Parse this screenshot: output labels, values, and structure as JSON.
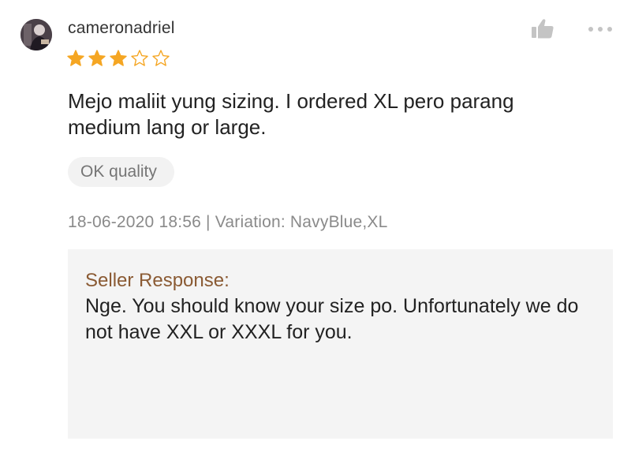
{
  "review": {
    "avatar_icon": "user-avatar",
    "username": "cameronadriel",
    "rating": 3,
    "rating_max": 5,
    "star_filled_color": "#f5a623",
    "like_icon": "thumbs-up-icon",
    "more_icon": "more-horizontal-icon",
    "text": "Mejo maliit yung sizing. I ordered XL pero parang medium lang or large.",
    "tag": "OK quality",
    "meta": "18-06-2020 18:56 | Variation: NavyBlue,XL"
  },
  "seller_response": {
    "title": "Seller Response:",
    "text": "Nge. You should know your size po. Unfortunately we do not have XXL or XXXL for you."
  }
}
